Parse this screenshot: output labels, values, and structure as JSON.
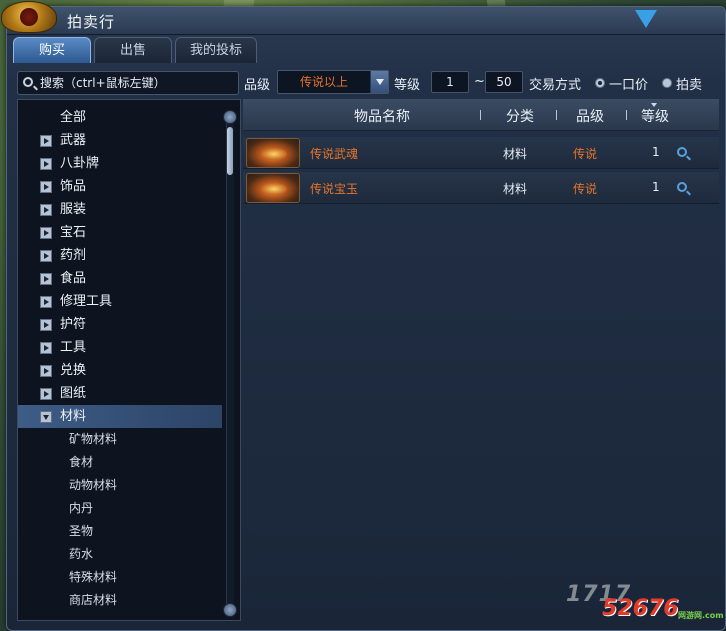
{
  "window": {
    "title": "拍卖行"
  },
  "tabs": [
    {
      "label": "购买",
      "active": true
    },
    {
      "label": "出售",
      "active": false
    },
    {
      "label": "我的投标",
      "active": false
    }
  ],
  "toolbar": {
    "search_placeholder": "搜索（ctrl+鼠标左键）",
    "grade_label": "品级",
    "grade_value": "传说以上",
    "level_label": "等级",
    "level_min": "1",
    "level_sep": "~",
    "level_max": "50",
    "trade_label": "交易方式",
    "option_fixed": "一口价",
    "option_auction": "拍卖"
  },
  "categories": [
    {
      "label": "全部",
      "type": "root"
    },
    {
      "label": "武器",
      "type": "group"
    },
    {
      "label": "八卦牌",
      "type": "group"
    },
    {
      "label": "饰品",
      "type": "group"
    },
    {
      "label": "服装",
      "type": "group"
    },
    {
      "label": "宝石",
      "type": "group"
    },
    {
      "label": "药剂",
      "type": "group"
    },
    {
      "label": "食品",
      "type": "group"
    },
    {
      "label": "修理工具",
      "type": "group"
    },
    {
      "label": "护符",
      "type": "group"
    },
    {
      "label": "工具",
      "type": "group"
    },
    {
      "label": "兑换",
      "type": "group"
    },
    {
      "label": "图纸",
      "type": "group"
    },
    {
      "label": "材料",
      "type": "group-open",
      "selected": true
    },
    {
      "label": "矿物材料",
      "type": "sub"
    },
    {
      "label": "食材",
      "type": "sub"
    },
    {
      "label": "动物材料",
      "type": "sub"
    },
    {
      "label": "内丹",
      "type": "sub"
    },
    {
      "label": "圣物",
      "type": "sub"
    },
    {
      "label": "药水",
      "type": "sub"
    },
    {
      "label": "特殊材料",
      "type": "sub"
    },
    {
      "label": "商店材料",
      "type": "sub"
    }
  ],
  "table": {
    "headers": {
      "name": "物品名称",
      "category": "分类",
      "grade": "品级",
      "level": "等级"
    },
    "rows": [
      {
        "name": "传说武魂",
        "category": "材料",
        "grade": "传说",
        "level": "1"
      },
      {
        "name": "传说宝玉",
        "category": "材料",
        "grade": "传说",
        "level": "1"
      }
    ]
  },
  "watermark": {
    "text": "1717",
    "number": "52676",
    "sub": "网游网.com"
  },
  "colors": {
    "accent": "#2d5891",
    "legendary": "#e8742a",
    "panel": "#0d1420"
  },
  "icons": [
    "search-icon",
    "dropdown-arrow-icon",
    "expand-arrow-icon",
    "scroll-up-icon",
    "scroll-down-icon",
    "item-detail-search-icon",
    "corner-triangle-icon"
  ]
}
